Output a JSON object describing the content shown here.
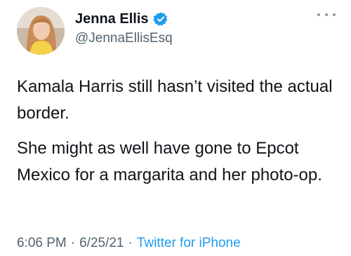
{
  "tweet": {
    "author": {
      "display_name": "Jenna Ellis",
      "handle": "@JennaEllisEsq",
      "verified": true,
      "verified_color": "#1d9bf0"
    },
    "paragraphs": [
      "Kamala Harris still hasn’t visited the actual border.",
      "She might as well have gone to Epcot Mexico for a margarita and her photo-op."
    ],
    "time": "6:06 PM",
    "date": "6/25/21",
    "separator": "·",
    "source": "Twitter for iPhone",
    "link_color": "#1d9bf0",
    "more_icon": "more-horizontal-icon"
  }
}
